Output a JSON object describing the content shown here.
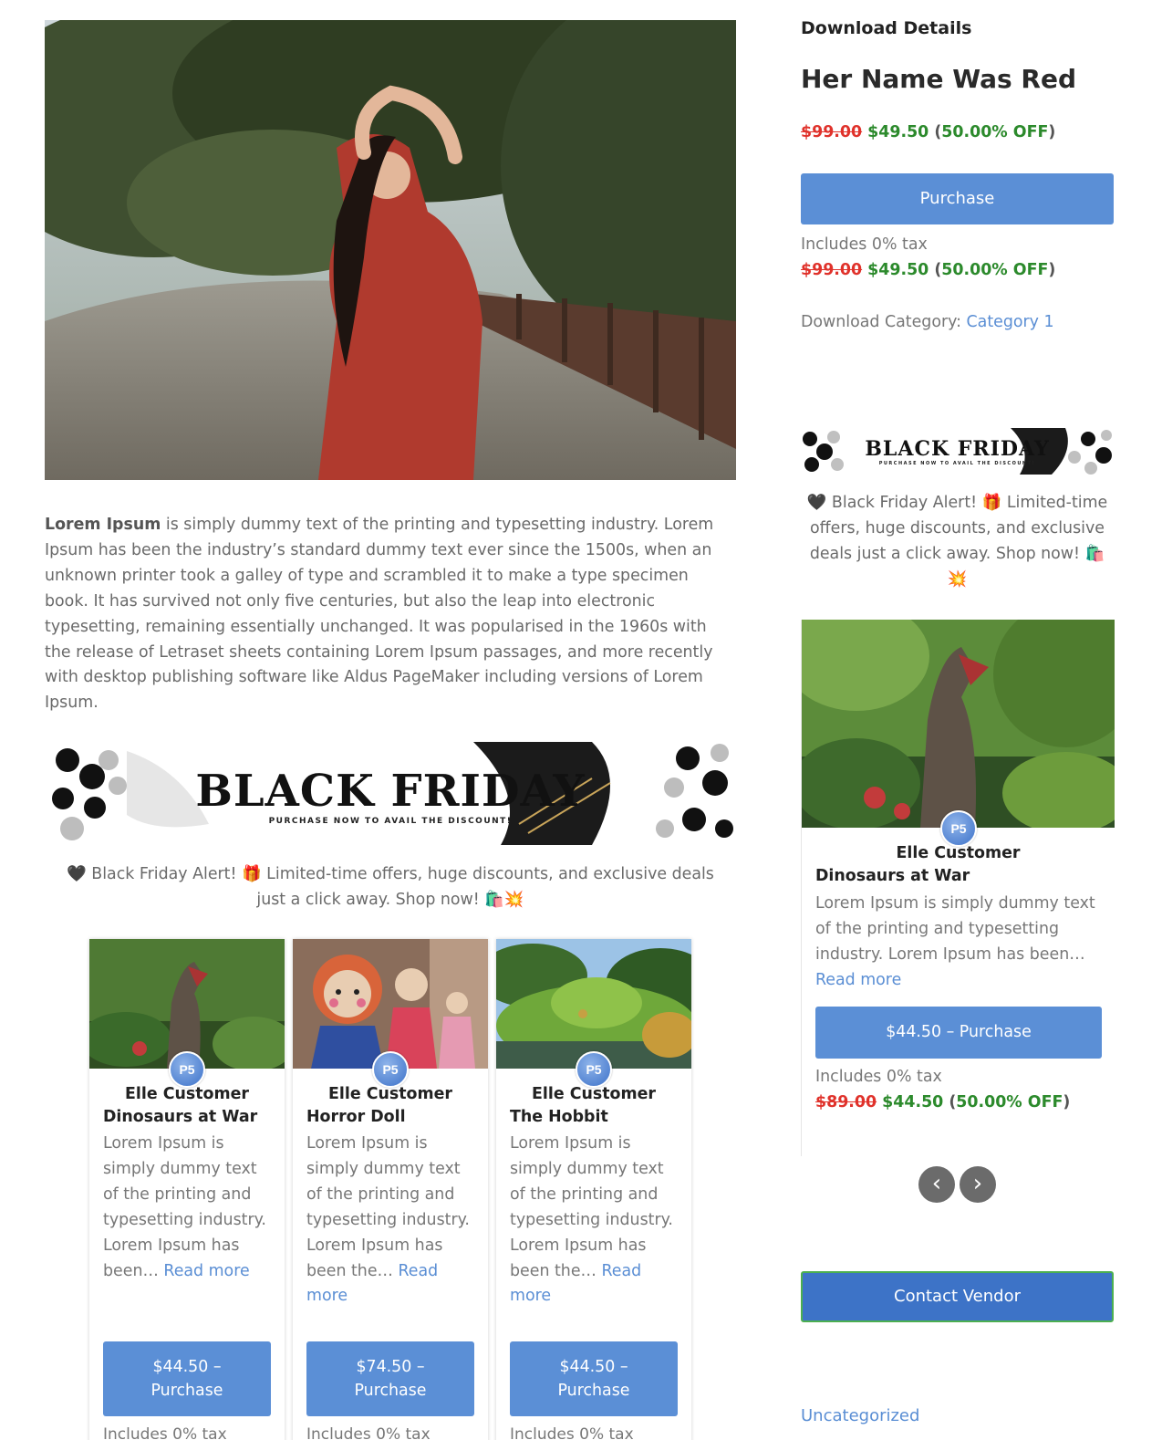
{
  "main": {
    "intro_bold": "Lorem Ipsum",
    "intro_text": " is simply dummy text of the printing and typesetting industry. Lorem Ipsum has been the industry’s standard dummy text ever since the 1500s, when an unknown printer took a galley of type and scrambled it to make a type specimen book. It has survived not only five centuries, but also the leap into electronic typesetting, remaining essentially unchanged. It was popularised in the 1960s with the release of Letraset sheets containing Lorem Ipsum passages, and more recently with desktop publishing software like Aldus PageMaker including versions of Lorem Ipsum.",
    "banner_title": "BLACK FRIDAY",
    "banner_subtitle": "PURCHASE NOW TO AVAIL THE DISCOUNT!",
    "promo_text": "🖤 Black Friday Alert! 🎁 Limited-time offers, huge discounts, and exclusive deals just a click away. Shop now! 🛍️💥"
  },
  "cards": [
    {
      "vendor": "Elle Customer",
      "avatar_text": "P5",
      "title": "Dinosaurs at War",
      "excerpt": "Lorem Ipsum is simply dummy text of the printing and typesetting industry. Lorem Ipsum has been… ",
      "read_more": "Read more",
      "buy_price": "$44.50 –",
      "buy_label": "Purchase",
      "tax": "Includes 0% tax"
    },
    {
      "vendor": "Elle Customer",
      "avatar_text": "P5",
      "title": "Horror Doll",
      "excerpt": "Lorem Ipsum is simply dummy text of the printing and typesetting industry. Lorem Ipsum has been the… ",
      "read_more": "Read more",
      "buy_price": "$74.50 –",
      "buy_label": "Purchase",
      "tax": "Includes 0% tax"
    },
    {
      "vendor": "Elle Customer",
      "avatar_text": "P5",
      "title": "The Hobbit",
      "excerpt": "Lorem Ipsum is simply dummy text of the printing and typesetting industry. Lorem Ipsum has been the… ",
      "read_more": "Read more",
      "buy_price": "$44.50 –",
      "buy_label": "Purchase",
      "tax": "Includes 0% tax"
    }
  ],
  "sidebar": {
    "heading": "Download Details",
    "title": "Her Name Was Red",
    "price_old": "$99.00",
    "price_new": "$49.50",
    "discount": "50.00% OFF",
    "purchase_label": "Purchase",
    "tax": "Includes 0% tax",
    "category_label": "Download Category: ",
    "category_link": "Category 1",
    "banner_title": "BLACK FRIDAY",
    "banner_subtitle": "PURCHASE NOW TO AVAIL THE DISCOUNT!",
    "promo_text": "🖤 Black Friday Alert! 🎁 Limited-time offers, huge discounts, and exclusive deals just a click away. Shop now! 🛍️ 💥",
    "slider_card": {
      "vendor": "Elle Customer",
      "avatar_text": "P5",
      "title": "Dinosaurs at War",
      "excerpt": "Lorem Ipsum is simply dummy text of the printing and typesetting industry. Lorem Ipsum has been… ",
      "read_more": "Read more",
      "buy_label": "$44.50 – Purchase",
      "tax": "Includes 0% tax",
      "price_old": "$89.00",
      "price_new": "$44.50",
      "discount": "50.00% OFF"
    },
    "prev_arrow": "‹",
    "next_arrow": "›",
    "contact_label": "Contact Vendor",
    "uncategorized": "Uncategorized"
  },
  "colors": {
    "button": "#5b8fd6",
    "link": "#5a8ed4",
    "old_price": "#e0322b",
    "new_price": "#2c8a2c",
    "contact_border": "#4caf50"
  }
}
